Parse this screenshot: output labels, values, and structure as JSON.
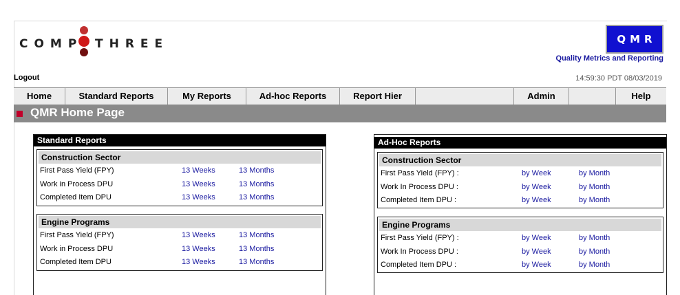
{
  "header": {
    "logo_left": "COMP",
    "logo_right": "THREE",
    "badge": "QMR",
    "badge_subtitle": "Quality Metrics and Reporting",
    "logout": "Logout",
    "timestamp": "14:59:30 PDT 08/03/2019"
  },
  "nav": [
    "Home",
    "Standard Reports",
    "My Reports",
    "Ad-hoc Reports",
    "Report Hier",
    "",
    "Admin",
    "",
    "Help"
  ],
  "page_title": "QMR Home Page",
  "standard": {
    "title": "Standard Reports",
    "groups": [
      {
        "name": "Construction Sector",
        "rows": [
          {
            "label": "First Pass Yield (FPY)",
            "link1": "13 Weeks",
            "link2": "13 Months"
          },
          {
            "label": "Work in Process DPU",
            "link1": "13 Weeks",
            "link2": "13 Months"
          },
          {
            "label": "Completed Item DPU",
            "link1": "13 Weeks",
            "link2": "13 Months"
          }
        ]
      },
      {
        "name": "Engine Programs",
        "rows": [
          {
            "label": "First Pass Yield (FPY)",
            "link1": "13 Weeks",
            "link2": "13 Months"
          },
          {
            "label": "Work in Process DPU",
            "link1": "13 Weeks",
            "link2": "13 Months"
          },
          {
            "label": "Completed Item DPU",
            "link1": "13 Weeks",
            "link2": "13 Months"
          }
        ]
      }
    ]
  },
  "adhoc": {
    "title": "Ad-Hoc Reports",
    "groups": [
      {
        "name": "Construction Sector",
        "rows": [
          {
            "label": "First Pass Yield (FPY) :",
            "link1": "by Week",
            "link2": "by Month"
          },
          {
            "label": "Work In Process DPU :",
            "link1": "by Week",
            "link2": "by Month"
          },
          {
            "label": "Completed Item DPU :",
            "link1": "by Week",
            "link2": "by Month"
          }
        ]
      },
      {
        "name": "Engine Programs",
        "rows": [
          {
            "label": "First Pass Yield (FPY) :",
            "link1": "by Week",
            "link2": "by Month"
          },
          {
            "label": "Work In Process DPU :",
            "link1": "by Week",
            "link2": "by Month"
          },
          {
            "label": "Completed Item DPU :",
            "link1": "by Week",
            "link2": "by Month"
          }
        ]
      }
    ]
  }
}
